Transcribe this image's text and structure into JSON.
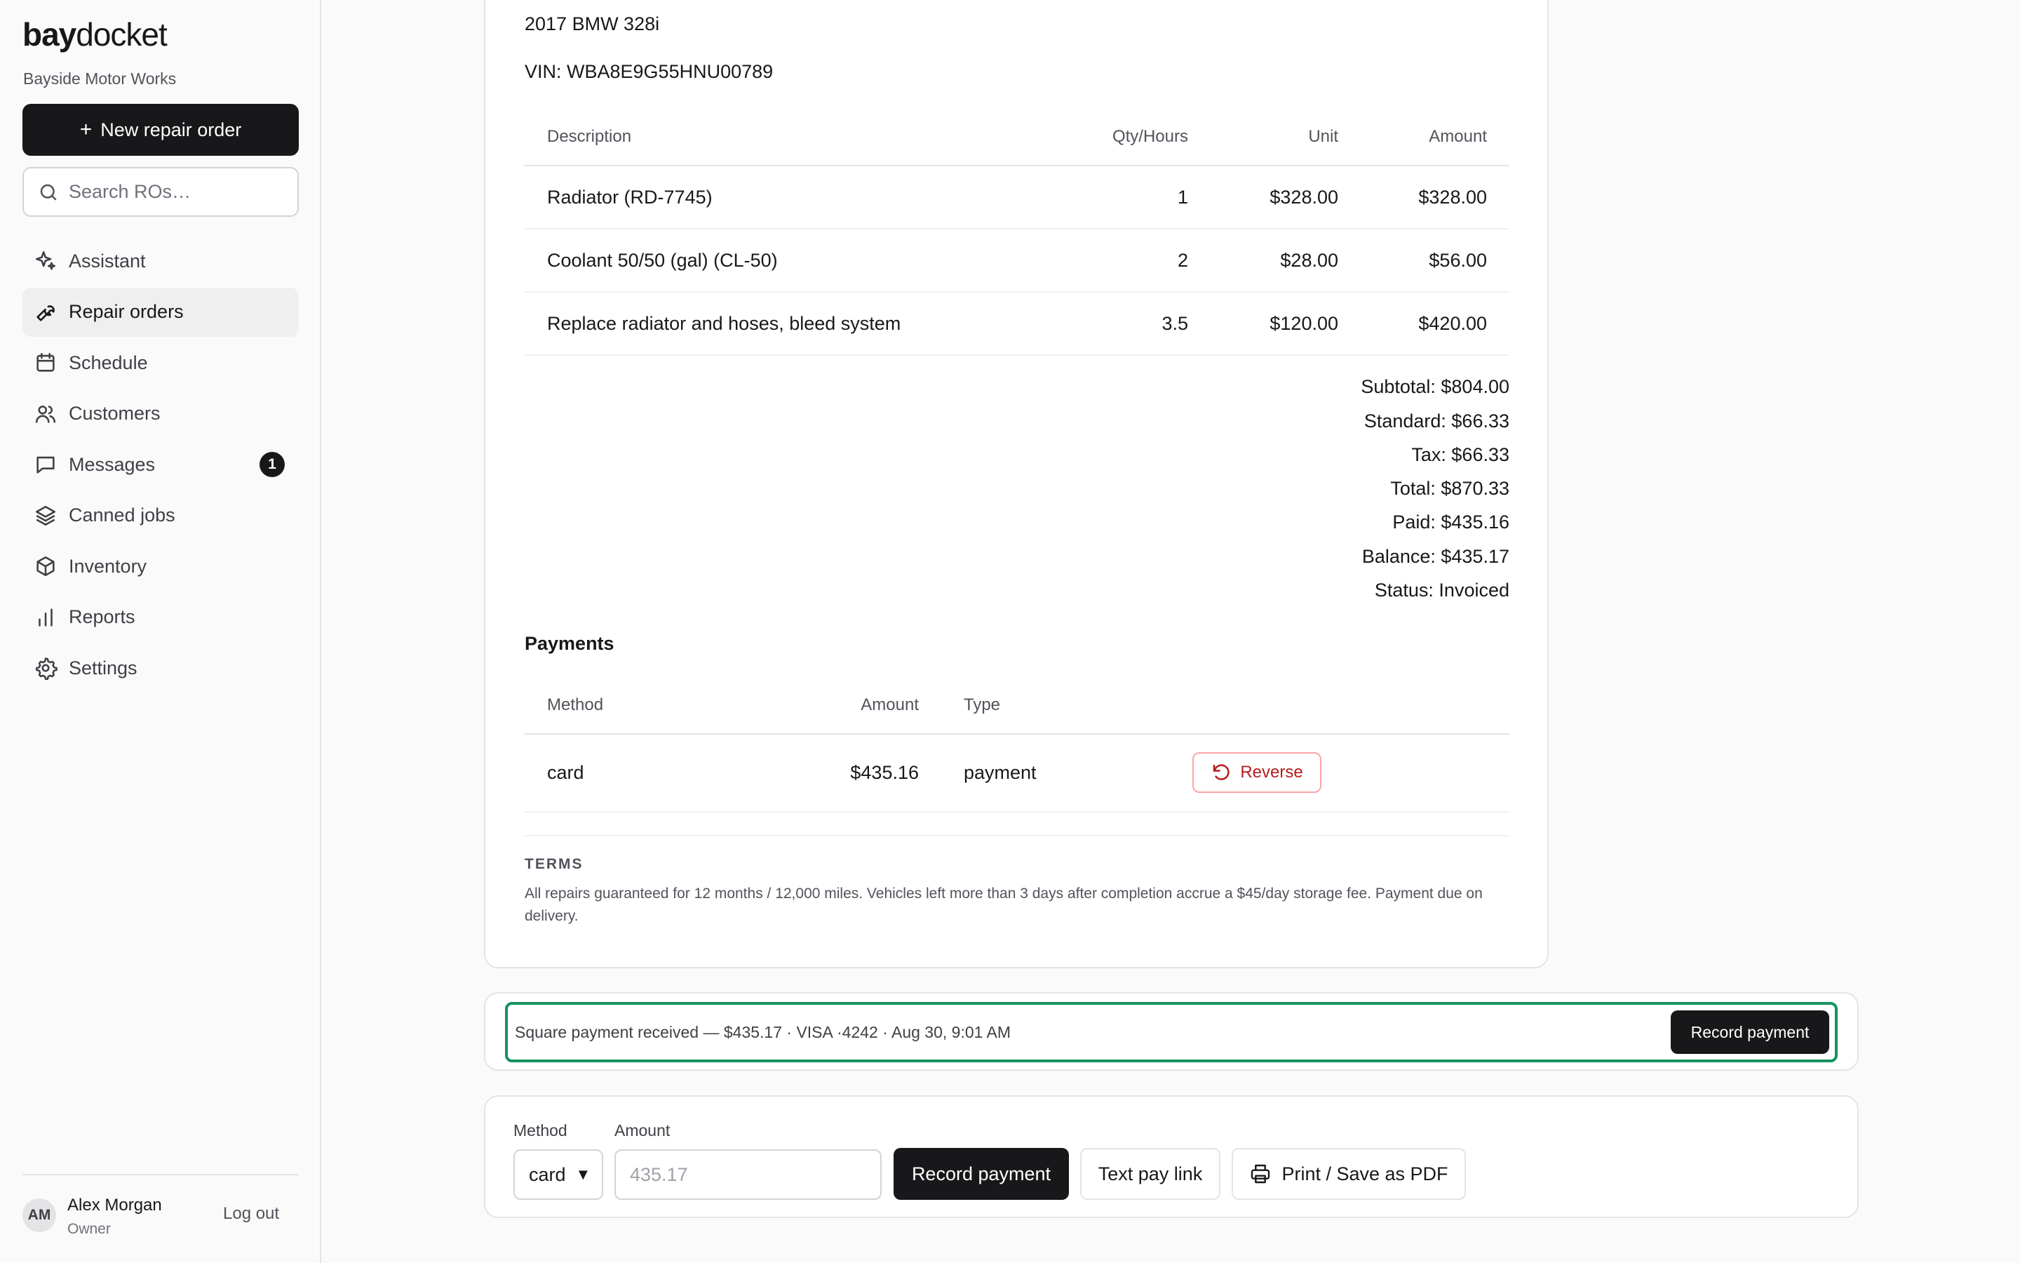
{
  "brand": {
    "part1": "bay",
    "part2": "docket",
    "shop": "Bayside Motor Works"
  },
  "sidebar": {
    "new_button": "New repair order",
    "search_placeholder": "Search ROs…",
    "items": [
      {
        "label": "Assistant",
        "icon": "sparkle-icon"
      },
      {
        "label": "Repair orders",
        "icon": "wrench-icon",
        "active": true
      },
      {
        "label": "Schedule",
        "icon": "calendar-icon"
      },
      {
        "label": "Customers",
        "icon": "users-icon"
      },
      {
        "label": "Messages",
        "icon": "message-icon",
        "badge": "1"
      },
      {
        "label": "Canned jobs",
        "icon": "layers-icon"
      },
      {
        "label": "Inventory",
        "icon": "box-icon"
      },
      {
        "label": "Reports",
        "icon": "bar-chart-icon"
      },
      {
        "label": "Settings",
        "icon": "gear-icon"
      }
    ]
  },
  "user": {
    "initials": "AM",
    "name": "Alex Morgan",
    "role": "Owner",
    "logout": "Log out"
  },
  "invoice": {
    "vehicle": "2017 BMW 328i",
    "vin": "VIN: WBA8E9G55HNU00789",
    "columns": {
      "description": "Description",
      "qty": "Qty/Hours",
      "unit": "Unit",
      "amount": "Amount"
    },
    "lines": [
      {
        "description": "Radiator (RD-7745)",
        "qty": "1",
        "unit": "$328.00",
        "amount": "$328.00"
      },
      {
        "description": "Coolant 50/50 (gal) (CL-50)",
        "qty": "2",
        "unit": "$28.00",
        "amount": "$56.00"
      },
      {
        "description": "Replace radiator and hoses, bleed system",
        "qty": "3.5",
        "unit": "$120.00",
        "amount": "$420.00"
      }
    ],
    "totals": [
      "Subtotal: $804.00",
      "Standard: $66.33",
      "Tax: $66.33",
      "Total: $870.33",
      "Paid: $435.16",
      "Balance: $435.17",
      "Status: Invoiced"
    ],
    "payments": {
      "title": "Payments",
      "columns": {
        "method": "Method",
        "amount": "Amount",
        "type": "Type"
      },
      "rows": [
        {
          "method": "card",
          "amount": "$435.16",
          "type": "payment",
          "action": "Reverse"
        }
      ]
    },
    "terms_title": "TERMS",
    "terms": "All repairs guaranteed for 12 months / 12,000 miles. Vehicles left more than 3 days after completion accrue a $45/day storage fee. Payment due on delivery."
  },
  "notification": {
    "message": "Square payment received — $435.17 · VISA ·4242 · Aug 30, 9:01 AM",
    "button": "Record payment",
    "accent": "#15935f"
  },
  "payment_form": {
    "method_label": "Method",
    "method_value": "card",
    "amount_label": "Amount",
    "amount_placeholder": "435.17",
    "record_button": "Record payment",
    "text_link_button": "Text pay link",
    "print_button": "Print / Save as PDF"
  }
}
